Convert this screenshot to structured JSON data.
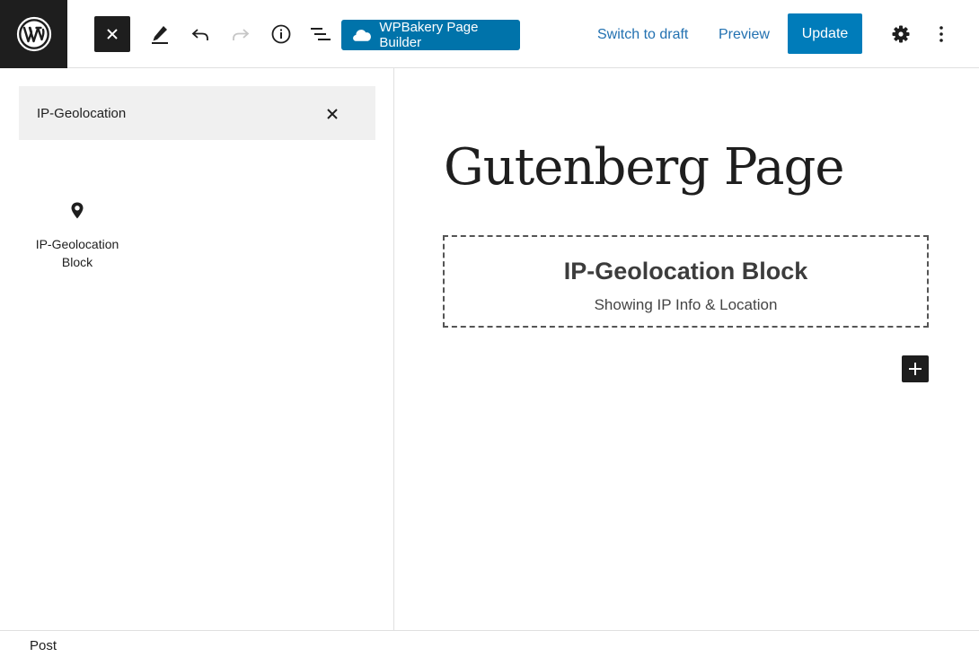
{
  "toolbar": {
    "wpbakery_label": "WPBakery Page Builder",
    "switch_to_draft": "Switch to draft",
    "preview": "Preview",
    "update": "Update"
  },
  "inserter": {
    "search_value": "IP-Geolocation",
    "results": [
      {
        "label": "IP-Geolocation Block",
        "icon": "map-pin-icon"
      }
    ]
  },
  "editor": {
    "title": "Gutenberg Page",
    "block": {
      "title": "IP-Geolocation Block",
      "subtitle": "Showing IP Info & Location"
    }
  },
  "footer": {
    "breadcrumb": "Post"
  },
  "colors": {
    "accent": "#007cba",
    "wpbakery": "#0073aa",
    "link": "#2271b1",
    "dark": "#1e1e1e"
  }
}
